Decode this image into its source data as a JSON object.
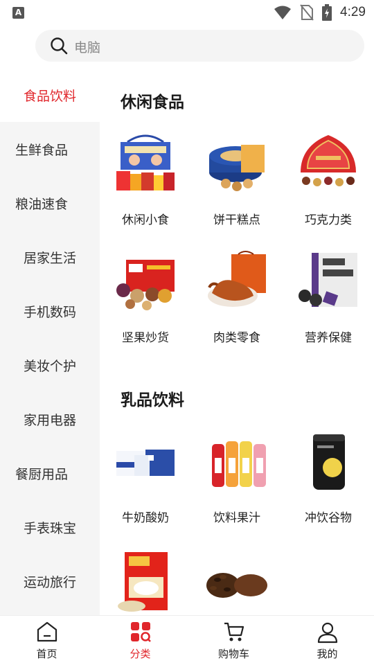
{
  "status_bar": {
    "time": "4:29",
    "notification_letter": "A"
  },
  "search": {
    "placeholder": "电脑"
  },
  "sidebar": {
    "items": [
      {
        "label": "食品饮料",
        "active": true
      },
      {
        "label": "生鲜食品"
      },
      {
        "label": "粮油速食"
      },
      {
        "label": "居家生活"
      },
      {
        "label": "手机数码"
      },
      {
        "label": "美妆个护"
      },
      {
        "label": "家用电器"
      },
      {
        "label": "餐厨用品"
      },
      {
        "label": "手表珠宝"
      },
      {
        "label": "运动旅行"
      }
    ]
  },
  "sections": [
    {
      "title": "休闲食品",
      "products": [
        {
          "label": "休闲小食",
          "icon": "snack-gift-box"
        },
        {
          "label": "饼干糕点",
          "icon": "cookie-tin"
        },
        {
          "label": "巧克力类",
          "icon": "chocolate-box"
        },
        {
          "label": "坚果炒货",
          "icon": "nuts-gift-box"
        },
        {
          "label": "肉类零食",
          "icon": "roast-duck"
        },
        {
          "label": "营养保健",
          "icon": "ejiao-pills"
        }
      ]
    },
    {
      "title": "乳品饮料",
      "products": [
        {
          "label": "牛奶酸奶",
          "icon": "milk-cartons"
        },
        {
          "label": "饮料果汁",
          "icon": "juice-bottles"
        },
        {
          "label": "冲饮谷物",
          "icon": "black-jar"
        },
        {
          "label": "",
          "icon": "oatmeal-box"
        },
        {
          "label": "",
          "icon": "coffee-beans"
        }
      ]
    }
  ],
  "bottom_nav": [
    {
      "label": "首页",
      "icon": "home-icon"
    },
    {
      "label": "分类",
      "icon": "category-icon",
      "active": true
    },
    {
      "label": "购物车",
      "icon": "cart-icon"
    },
    {
      "label": "我的",
      "icon": "user-icon"
    }
  ],
  "colors": {
    "accent": "#e0262b",
    "sidebar_bg": "#f5f5f5",
    "search_bg": "#f4f4f4"
  }
}
